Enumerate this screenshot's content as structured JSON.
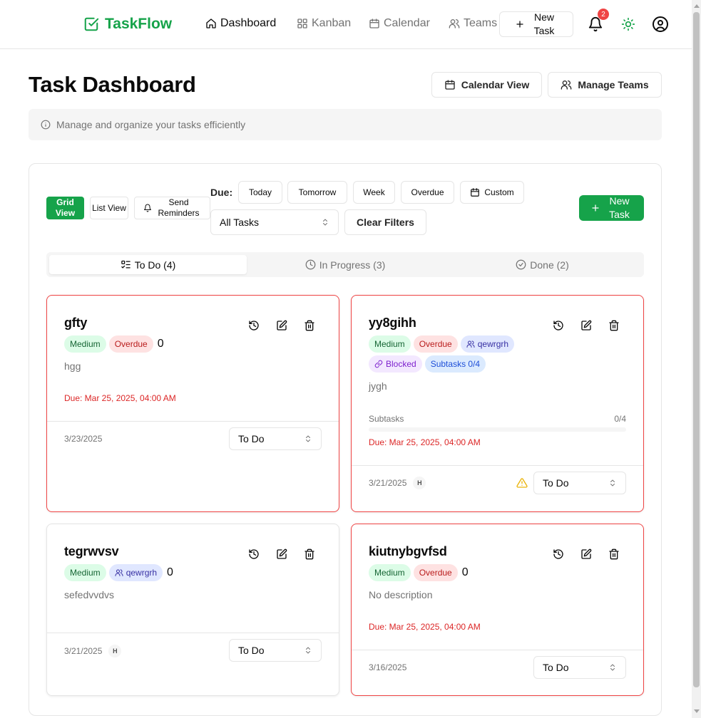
{
  "app": {
    "name": "TaskFlow"
  },
  "nav": {
    "links": [
      "Dashboard",
      "Kanban",
      "Calendar",
      "Teams"
    ],
    "new_task": "New Task",
    "notification_count": "2"
  },
  "header": {
    "title": "Task Dashboard",
    "calendar_view": "Calendar View",
    "manage_teams": "Manage Teams",
    "info": "Manage and organize your tasks efficiently"
  },
  "toolbar": {
    "grid_view": "Grid View",
    "list_view": "List View",
    "send_reminders": "Send Reminders",
    "due_label": "Due:",
    "due_filters": [
      "Today",
      "Tomorrow",
      "Week",
      "Overdue",
      "Custom"
    ],
    "task_filter": "All Tasks",
    "clear_filters": "Clear Filters",
    "new_task": "New Task"
  },
  "tabs": [
    {
      "label": "To Do (4)",
      "active": true
    },
    {
      "label": "In Progress (3)",
      "active": false
    },
    {
      "label": "Done (2)",
      "active": false
    }
  ],
  "tasks": [
    {
      "title": "gfty",
      "priority": "Medium",
      "overdue_badge": "Overdue",
      "count": "0",
      "description": "hgg",
      "due": "Due: Mar 25, 2025, 04:00 AM",
      "date": "3/23/2025",
      "status": "To Do"
    },
    {
      "title": "yy8gihh",
      "priority": "Medium",
      "overdue_badge": "Overdue",
      "team": "qewrgrh",
      "blocked": "Blocked",
      "subtasks_badge": "Subtasks 0/4",
      "description": "jygh",
      "subtasks_label": "Subtasks",
      "subtasks_count": "0/4",
      "subtasks_progress": 0,
      "due": "Due: Mar 25, 2025, 04:00 AM",
      "date": "3/21/2025",
      "avatar": "H",
      "status": "To Do",
      "warning_icon": "alert-triangle-icon"
    },
    {
      "title": "tegrwvsv",
      "priority": "Medium",
      "team": "qewrgrh",
      "count": "0",
      "description": "sefedvvdvs",
      "date": "3/21/2025",
      "avatar": "H",
      "status": "To Do"
    },
    {
      "title": "kiutnybgvfsd",
      "priority": "Medium",
      "overdue_badge": "Overdue",
      "count": "0",
      "description": "No description",
      "due": "Due: Mar 25, 2025, 04:00 AM",
      "date": "3/16/2025",
      "status": "To Do"
    }
  ],
  "colors": {
    "brand": "#16a34a",
    "danger": "#ef4444",
    "muted": "#737373"
  }
}
